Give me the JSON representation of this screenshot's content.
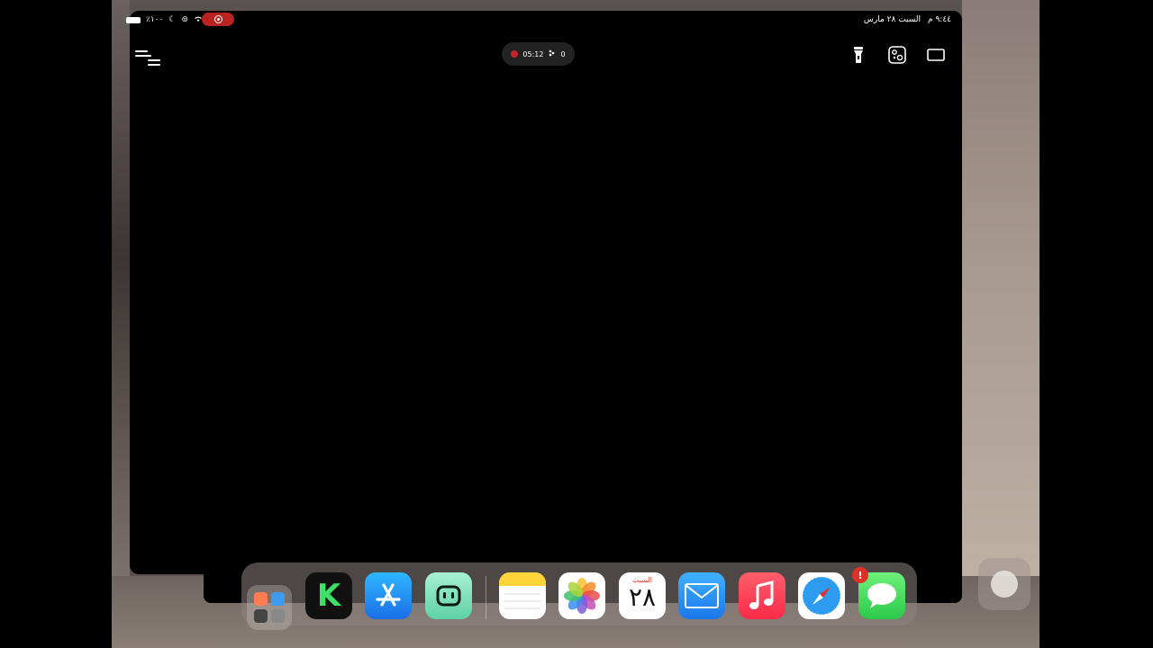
{
  "status_bar": {
    "battery_text": "٪١٠٠",
    "time": "٩:٤٤ م",
    "date": "السبت ٢٨ مارس"
  },
  "recorder": {
    "elapsed": "05:12",
    "count": "0"
  },
  "dock": {
    "apps": [
      {
        "name": "folder",
        "label": ""
      },
      {
        "name": "kinemaster",
        "label": "K"
      },
      {
        "name": "app-store",
        "label": ""
      },
      {
        "name": "chat-app",
        "label": ""
      },
      {
        "name": "notes",
        "label": ""
      },
      {
        "name": "photos",
        "label": ""
      },
      {
        "name": "calendar",
        "label": "٢٨"
      },
      {
        "name": "mail",
        "label": ""
      },
      {
        "name": "music",
        "label": ""
      },
      {
        "name": "safari",
        "label": ""
      },
      {
        "name": "messages",
        "label": ""
      }
    ],
    "calendar_day": "السبت",
    "calendar_date": "٢٨",
    "messages_badge": "!"
  },
  "colors": {
    "record_red": "#c0262b",
    "messages_green": "#34c759",
    "music_red": "#fc3c44",
    "mail_blue": "#1e8cf0"
  }
}
